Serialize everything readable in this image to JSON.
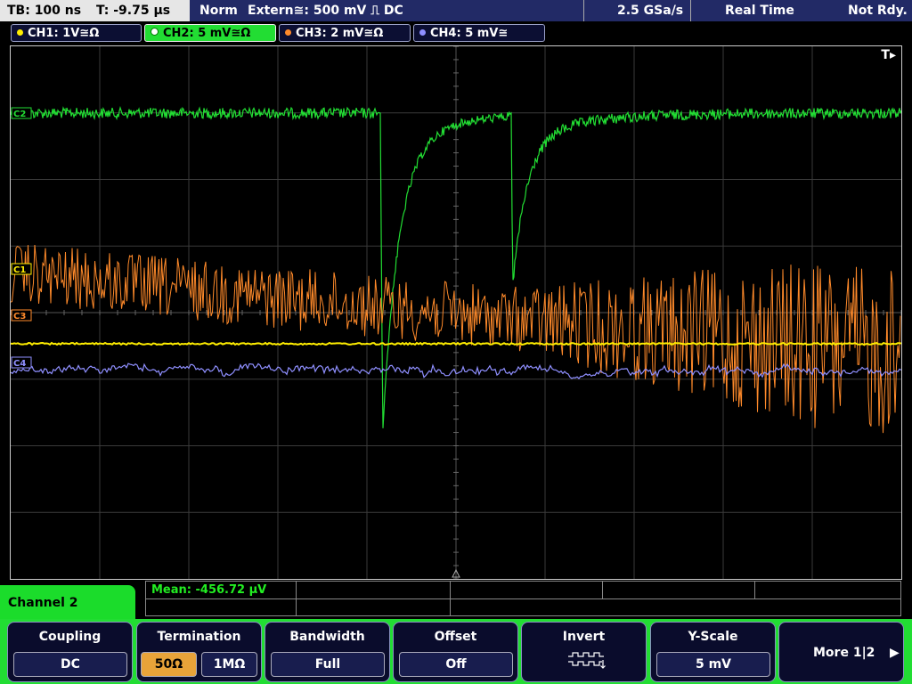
{
  "topbar": {
    "tb": "TB: 100 ns",
    "t": "T: -9.75 µs",
    "mode": "Norm",
    "trigger": "Extern≅: 500 mV ⎍ DC",
    "samplerate": "2.5 GSa/s",
    "acq": "Real Time",
    "status": "Not Rdy."
  },
  "channels": [
    {
      "label": "CH1: 1V≅Ω",
      "color": "#ffee00"
    },
    {
      "label": "CH2: 5 mV≅Ω",
      "color": "#22dd33"
    },
    {
      "label": "CH3: 2 mV≅Ω",
      "color": "#ff8a2a"
    },
    {
      "label": "CH4: 5 mV≅",
      "color": "#8f8fff"
    }
  ],
  "display": {
    "trigger_marker": "T▸",
    "ch_markers": [
      "C2",
      "C1",
      "C3",
      "C4"
    ]
  },
  "measurement": {
    "text": "Mean: -456.72 µV"
  },
  "menu": {
    "title": "Channel 2",
    "coupling": {
      "title": "Coupling",
      "value": "DC"
    },
    "termination": {
      "title": "Termination",
      "opt1": "50Ω",
      "opt2": "1MΩ"
    },
    "bandwidth": {
      "title": "Bandwidth",
      "value": "Full"
    },
    "offset": {
      "title": "Offset",
      "value": "Off"
    },
    "invert": {
      "title": "Invert"
    },
    "yscale": {
      "title": "Y-Scale",
      "value": "5 mV"
    },
    "more": {
      "label": "More 1|2"
    }
  }
}
